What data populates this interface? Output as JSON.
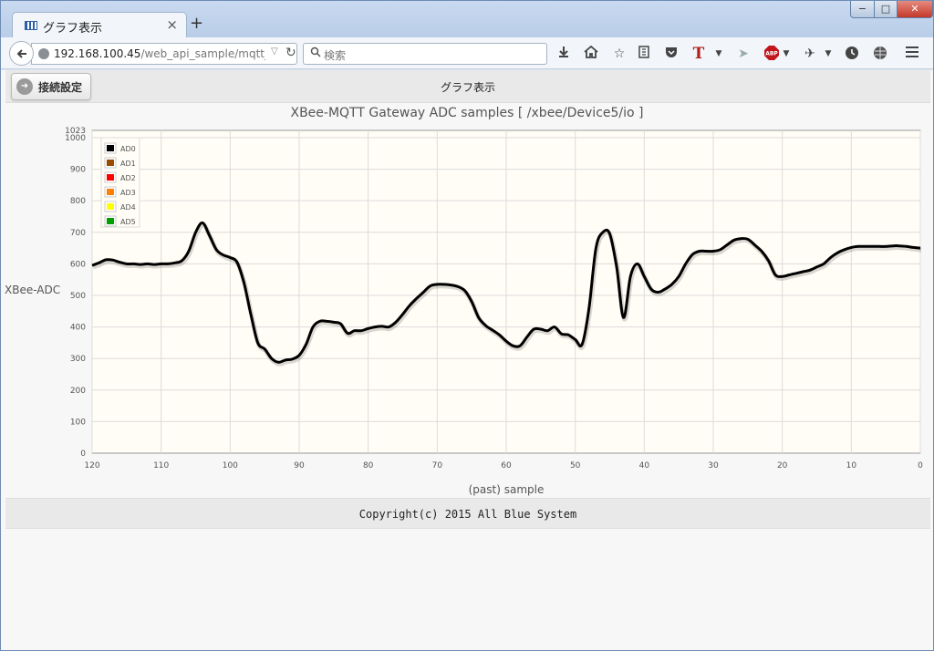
{
  "browser": {
    "tab_title": "グラフ表示",
    "tab_close": "×",
    "new_tab": "+",
    "url_host": "192.168.100.45",
    "url_path": "/web_api_sample/mqtt_xbee_",
    "search_placeholder": "検索",
    "win_min": "−",
    "win_max": "□",
    "win_close": "✕"
  },
  "header": {
    "connect_button": "接続設定",
    "title": "グラフ表示"
  },
  "chart_data": {
    "type": "line",
    "title": "XBee-MQTT Gateway ADC samples [ /xbee/Device5/io ]",
    "xlabel": "(past) sample",
    "ylabel": "XBee-ADC",
    "xlim": [
      120,
      0
    ],
    "ylim": [
      0,
      1023
    ],
    "x_ticks": [
      120,
      110,
      100,
      90,
      80,
      70,
      60,
      50,
      40,
      30,
      20,
      10,
      0
    ],
    "y_ticks": [
      0,
      100,
      200,
      300,
      400,
      500,
      600,
      700,
      800,
      900,
      1000,
      1023
    ],
    "grid": true,
    "legend_position": "top-left",
    "legend": [
      "AD0",
      "AD1",
      "AD2",
      "AD3",
      "AD4",
      "AD5"
    ],
    "series": [
      {
        "name": "AD0",
        "color": "#000000",
        "x": [
          120,
          119,
          118,
          117,
          116,
          115,
          114,
          113,
          112,
          111,
          110,
          109,
          108,
          107,
          106,
          105,
          104,
          103,
          102,
          101,
          100,
          99,
          98,
          97,
          96,
          95,
          94,
          93,
          92,
          91,
          90,
          89,
          88,
          87,
          86,
          85,
          84,
          83,
          82,
          81,
          80,
          79,
          78,
          77,
          76,
          75,
          74,
          73,
          72,
          71,
          70,
          69,
          68,
          67,
          66,
          65,
          64,
          63,
          62,
          61,
          60,
          59,
          58,
          57,
          56,
          55,
          54,
          53,
          52,
          51,
          50,
          49,
          48,
          47,
          46,
          45,
          44,
          43,
          42,
          41,
          40,
          39,
          38,
          37,
          36,
          35,
          34,
          33,
          32,
          31,
          30,
          29,
          28,
          27,
          26,
          25,
          24,
          23,
          22,
          21,
          20,
          19,
          18,
          17,
          16,
          15,
          14,
          13,
          12,
          11,
          10,
          9,
          8,
          7,
          6,
          5,
          4,
          3,
          2,
          1,
          0
        ],
        "values": [
          595,
          603,
          613,
          612,
          605,
          600,
          600,
          598,
          600,
          598,
          600,
          600,
          603,
          610,
          640,
          700,
          730,
          690,
          645,
          628,
          620,
          605,
          540,
          440,
          350,
          330,
          300,
          288,
          295,
          298,
          310,
          345,
          400,
          418,
          418,
          415,
          410,
          380,
          388,
          388,
          395,
          400,
          402,
          400,
          415,
          440,
          468,
          490,
          510,
          530,
          535,
          535,
          533,
          528,
          515,
          480,
          430,
          405,
          390,
          375,
          355,
          340,
          340,
          368,
          393,
          393,
          388,
          400,
          378,
          375,
          360,
          345,
          460,
          650,
          700,
          695,
          590,
          430,
          560,
          600,
          560,
          520,
          510,
          520,
          535,
          560,
          600,
          630,
          640,
          640,
          640,
          645,
          660,
          675,
          680,
          678,
          660,
          640,
          610,
          565,
          560,
          565,
          570,
          575,
          580,
          590,
          600,
          620,
          635,
          645,
          652,
          655,
          655,
          655,
          655,
          655,
          657,
          657,
          655,
          652,
          650
        ]
      },
      {
        "name": "AD1",
        "color": "#994c00",
        "x": [],
        "values": []
      },
      {
        "name": "AD2",
        "color": "#ff0000",
        "x": [],
        "values": []
      },
      {
        "name": "AD3",
        "color": "#ff8000",
        "x": [],
        "values": []
      },
      {
        "name": "AD4",
        "color": "#ffff00",
        "x": [],
        "values": []
      },
      {
        "name": "AD5",
        "color": "#00a000",
        "x": [],
        "values": []
      }
    ]
  },
  "footer": {
    "copyright": "Copyright(c) 2015 All Blue System"
  }
}
